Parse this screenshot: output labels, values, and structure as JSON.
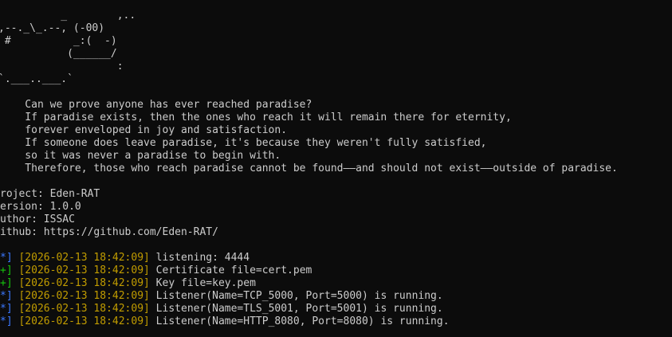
{
  "ascii_art": [
    "          _        ,..",
    ",--._\\_.--, (-00)",
    " #          _:(  -)",
    "           (______/",
    "                   :",
    "`.___..___.`"
  ],
  "poem": [
    "    Can we prove anyone has ever reached paradise?",
    "    If paradise exists, then the ones who reach it will remain there for eternity,",
    "    forever enveloped in joy and satisfaction.",
    "    If someone does leave paradise, it's because they weren't fully satisfied,",
    "    so it was never a paradise to begin with.",
    "    Therefore, those who reach paradise cannot be found——and should not exist——outside of paradise."
  ],
  "info": {
    "project": "roject: Eden-RAT",
    "version": "ersion: 1.0.0",
    "author": "uthor: ISSAC",
    "github": "ithub: https://github.com/Eden-RAT/"
  },
  "colors": {
    "info_marker": "#3b78ff",
    "success_marker": "#16c60c",
    "timestamp": "#c19c00",
    "text": "#cccccc",
    "background": "#0c0c0c"
  },
  "logs": [
    {
      "marker": "*]",
      "kind": "info",
      "timestamp": "[2026-02-13 18:42:09]",
      "message": " listening: 4444"
    },
    {
      "marker": "+]",
      "kind": "success",
      "timestamp": "[2026-02-13 18:42:09]",
      "message": " Certificate file=cert.pem"
    },
    {
      "marker": "+]",
      "kind": "success",
      "timestamp": "[2026-02-13 18:42:09]",
      "message": " Key file=key.pem"
    },
    {
      "marker": "*]",
      "kind": "info",
      "timestamp": "[2026-02-13 18:42:09]",
      "message": " Listener(Name=TCP_5000, Port=5000) is running."
    },
    {
      "marker": "*]",
      "kind": "info",
      "timestamp": "[2026-02-13 18:42:09]",
      "message": " Listener(Name=TLS_5001, Port=5001) is running."
    },
    {
      "marker": "*]",
      "kind": "info",
      "timestamp": "[2026-02-13 18:42:09]",
      "message": " Listener(Name=HTTP_8080, Port=8080) is running."
    }
  ]
}
